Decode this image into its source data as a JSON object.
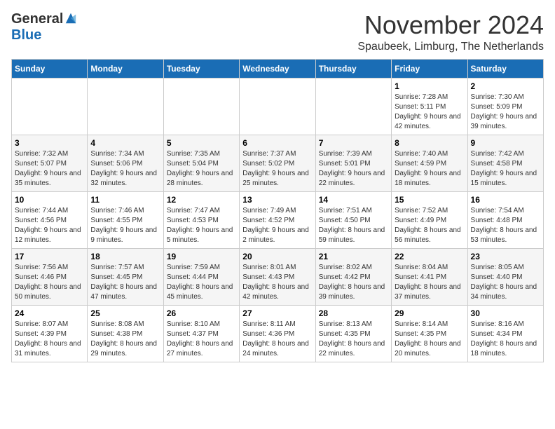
{
  "header": {
    "logo_general": "General",
    "logo_blue": "Blue",
    "month_title": "November 2024",
    "location": "Spaubeek, Limburg, The Netherlands"
  },
  "weekdays": [
    "Sunday",
    "Monday",
    "Tuesday",
    "Wednesday",
    "Thursday",
    "Friday",
    "Saturday"
  ],
  "weeks": [
    [
      {
        "day": "",
        "info": ""
      },
      {
        "day": "",
        "info": ""
      },
      {
        "day": "",
        "info": ""
      },
      {
        "day": "",
        "info": ""
      },
      {
        "day": "",
        "info": ""
      },
      {
        "day": "1",
        "info": "Sunrise: 7:28 AM\nSunset: 5:11 PM\nDaylight: 9 hours and 42 minutes."
      },
      {
        "day": "2",
        "info": "Sunrise: 7:30 AM\nSunset: 5:09 PM\nDaylight: 9 hours and 39 minutes."
      }
    ],
    [
      {
        "day": "3",
        "info": "Sunrise: 7:32 AM\nSunset: 5:07 PM\nDaylight: 9 hours and 35 minutes."
      },
      {
        "day": "4",
        "info": "Sunrise: 7:34 AM\nSunset: 5:06 PM\nDaylight: 9 hours and 32 minutes."
      },
      {
        "day": "5",
        "info": "Sunrise: 7:35 AM\nSunset: 5:04 PM\nDaylight: 9 hours and 28 minutes."
      },
      {
        "day": "6",
        "info": "Sunrise: 7:37 AM\nSunset: 5:02 PM\nDaylight: 9 hours and 25 minutes."
      },
      {
        "day": "7",
        "info": "Sunrise: 7:39 AM\nSunset: 5:01 PM\nDaylight: 9 hours and 22 minutes."
      },
      {
        "day": "8",
        "info": "Sunrise: 7:40 AM\nSunset: 4:59 PM\nDaylight: 9 hours and 18 minutes."
      },
      {
        "day": "9",
        "info": "Sunrise: 7:42 AM\nSunset: 4:58 PM\nDaylight: 9 hours and 15 minutes."
      }
    ],
    [
      {
        "day": "10",
        "info": "Sunrise: 7:44 AM\nSunset: 4:56 PM\nDaylight: 9 hours and 12 minutes."
      },
      {
        "day": "11",
        "info": "Sunrise: 7:46 AM\nSunset: 4:55 PM\nDaylight: 9 hours and 9 minutes."
      },
      {
        "day": "12",
        "info": "Sunrise: 7:47 AM\nSunset: 4:53 PM\nDaylight: 9 hours and 5 minutes."
      },
      {
        "day": "13",
        "info": "Sunrise: 7:49 AM\nSunset: 4:52 PM\nDaylight: 9 hours and 2 minutes."
      },
      {
        "day": "14",
        "info": "Sunrise: 7:51 AM\nSunset: 4:50 PM\nDaylight: 8 hours and 59 minutes."
      },
      {
        "day": "15",
        "info": "Sunrise: 7:52 AM\nSunset: 4:49 PM\nDaylight: 8 hours and 56 minutes."
      },
      {
        "day": "16",
        "info": "Sunrise: 7:54 AM\nSunset: 4:48 PM\nDaylight: 8 hours and 53 minutes."
      }
    ],
    [
      {
        "day": "17",
        "info": "Sunrise: 7:56 AM\nSunset: 4:46 PM\nDaylight: 8 hours and 50 minutes."
      },
      {
        "day": "18",
        "info": "Sunrise: 7:57 AM\nSunset: 4:45 PM\nDaylight: 8 hours and 47 minutes."
      },
      {
        "day": "19",
        "info": "Sunrise: 7:59 AM\nSunset: 4:44 PM\nDaylight: 8 hours and 45 minutes."
      },
      {
        "day": "20",
        "info": "Sunrise: 8:01 AM\nSunset: 4:43 PM\nDaylight: 8 hours and 42 minutes."
      },
      {
        "day": "21",
        "info": "Sunrise: 8:02 AM\nSunset: 4:42 PM\nDaylight: 8 hours and 39 minutes."
      },
      {
        "day": "22",
        "info": "Sunrise: 8:04 AM\nSunset: 4:41 PM\nDaylight: 8 hours and 37 minutes."
      },
      {
        "day": "23",
        "info": "Sunrise: 8:05 AM\nSunset: 4:40 PM\nDaylight: 8 hours and 34 minutes."
      }
    ],
    [
      {
        "day": "24",
        "info": "Sunrise: 8:07 AM\nSunset: 4:39 PM\nDaylight: 8 hours and 31 minutes."
      },
      {
        "day": "25",
        "info": "Sunrise: 8:08 AM\nSunset: 4:38 PM\nDaylight: 8 hours and 29 minutes."
      },
      {
        "day": "26",
        "info": "Sunrise: 8:10 AM\nSunset: 4:37 PM\nDaylight: 8 hours and 27 minutes."
      },
      {
        "day": "27",
        "info": "Sunrise: 8:11 AM\nSunset: 4:36 PM\nDaylight: 8 hours and 24 minutes."
      },
      {
        "day": "28",
        "info": "Sunrise: 8:13 AM\nSunset: 4:35 PM\nDaylight: 8 hours and 22 minutes."
      },
      {
        "day": "29",
        "info": "Sunrise: 8:14 AM\nSunset: 4:35 PM\nDaylight: 8 hours and 20 minutes."
      },
      {
        "day": "30",
        "info": "Sunrise: 8:16 AM\nSunset: 4:34 PM\nDaylight: 8 hours and 18 minutes."
      }
    ]
  ]
}
